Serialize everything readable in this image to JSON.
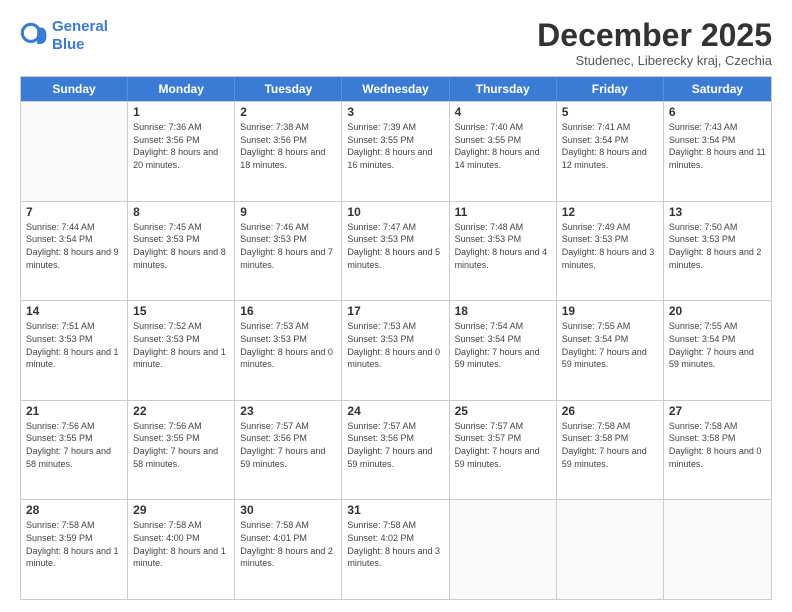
{
  "logo": {
    "line1": "General",
    "line2": "Blue"
  },
  "title": "December 2025",
  "subtitle": "Studenec, Liberecky kraj, Czechia",
  "days_of_week": [
    "Sunday",
    "Monday",
    "Tuesday",
    "Wednesday",
    "Thursday",
    "Friday",
    "Saturday"
  ],
  "weeks": [
    [
      {
        "day": "",
        "empty": true
      },
      {
        "day": "1",
        "sunrise": "7:36 AM",
        "sunset": "3:56 PM",
        "daylight": "8 hours and 20 minutes."
      },
      {
        "day": "2",
        "sunrise": "7:38 AM",
        "sunset": "3:56 PM",
        "daylight": "8 hours and 18 minutes."
      },
      {
        "day": "3",
        "sunrise": "7:39 AM",
        "sunset": "3:55 PM",
        "daylight": "8 hours and 16 minutes."
      },
      {
        "day": "4",
        "sunrise": "7:40 AM",
        "sunset": "3:55 PM",
        "daylight": "8 hours and 14 minutes."
      },
      {
        "day": "5",
        "sunrise": "7:41 AM",
        "sunset": "3:54 PM",
        "daylight": "8 hours and 12 minutes."
      },
      {
        "day": "6",
        "sunrise": "7:43 AM",
        "sunset": "3:54 PM",
        "daylight": "8 hours and 11 minutes."
      }
    ],
    [
      {
        "day": "7",
        "sunrise": "7:44 AM",
        "sunset": "3:54 PM",
        "daylight": "8 hours and 9 minutes."
      },
      {
        "day": "8",
        "sunrise": "7:45 AM",
        "sunset": "3:53 PM",
        "daylight": "8 hours and 8 minutes."
      },
      {
        "day": "9",
        "sunrise": "7:46 AM",
        "sunset": "3:53 PM",
        "daylight": "8 hours and 7 minutes."
      },
      {
        "day": "10",
        "sunrise": "7:47 AM",
        "sunset": "3:53 PM",
        "daylight": "8 hours and 5 minutes."
      },
      {
        "day": "11",
        "sunrise": "7:48 AM",
        "sunset": "3:53 PM",
        "daylight": "8 hours and 4 minutes."
      },
      {
        "day": "12",
        "sunrise": "7:49 AM",
        "sunset": "3:53 PM",
        "daylight": "8 hours and 3 minutes."
      },
      {
        "day": "13",
        "sunrise": "7:50 AM",
        "sunset": "3:53 PM",
        "daylight": "8 hours and 2 minutes."
      }
    ],
    [
      {
        "day": "14",
        "sunrise": "7:51 AM",
        "sunset": "3:53 PM",
        "daylight": "8 hours and 1 minute."
      },
      {
        "day": "15",
        "sunrise": "7:52 AM",
        "sunset": "3:53 PM",
        "daylight": "8 hours and 1 minute."
      },
      {
        "day": "16",
        "sunrise": "7:53 AM",
        "sunset": "3:53 PM",
        "daylight": "8 hours and 0 minutes."
      },
      {
        "day": "17",
        "sunrise": "7:53 AM",
        "sunset": "3:53 PM",
        "daylight": "8 hours and 0 minutes."
      },
      {
        "day": "18",
        "sunrise": "7:54 AM",
        "sunset": "3:54 PM",
        "daylight": "7 hours and 59 minutes."
      },
      {
        "day": "19",
        "sunrise": "7:55 AM",
        "sunset": "3:54 PM",
        "daylight": "7 hours and 59 minutes."
      },
      {
        "day": "20",
        "sunrise": "7:55 AM",
        "sunset": "3:54 PM",
        "daylight": "7 hours and 59 minutes."
      }
    ],
    [
      {
        "day": "21",
        "sunrise": "7:56 AM",
        "sunset": "3:55 PM",
        "daylight": "7 hours and 58 minutes."
      },
      {
        "day": "22",
        "sunrise": "7:56 AM",
        "sunset": "3:55 PM",
        "daylight": "7 hours and 58 minutes."
      },
      {
        "day": "23",
        "sunrise": "7:57 AM",
        "sunset": "3:56 PM",
        "daylight": "7 hours and 59 minutes."
      },
      {
        "day": "24",
        "sunrise": "7:57 AM",
        "sunset": "3:56 PM",
        "daylight": "7 hours and 59 minutes."
      },
      {
        "day": "25",
        "sunrise": "7:57 AM",
        "sunset": "3:57 PM",
        "daylight": "7 hours and 59 minutes."
      },
      {
        "day": "26",
        "sunrise": "7:58 AM",
        "sunset": "3:58 PM",
        "daylight": "7 hours and 59 minutes."
      },
      {
        "day": "27",
        "sunrise": "7:58 AM",
        "sunset": "3:58 PM",
        "daylight": "8 hours and 0 minutes."
      }
    ],
    [
      {
        "day": "28",
        "sunrise": "7:58 AM",
        "sunset": "3:59 PM",
        "daylight": "8 hours and 1 minute."
      },
      {
        "day": "29",
        "sunrise": "7:58 AM",
        "sunset": "4:00 PM",
        "daylight": "8 hours and 1 minute."
      },
      {
        "day": "30",
        "sunrise": "7:58 AM",
        "sunset": "4:01 PM",
        "daylight": "8 hours and 2 minutes."
      },
      {
        "day": "31",
        "sunrise": "7:58 AM",
        "sunset": "4:02 PM",
        "daylight": "8 hours and 3 minutes."
      },
      {
        "day": "",
        "empty": true
      },
      {
        "day": "",
        "empty": true
      },
      {
        "day": "",
        "empty": true
      }
    ]
  ]
}
